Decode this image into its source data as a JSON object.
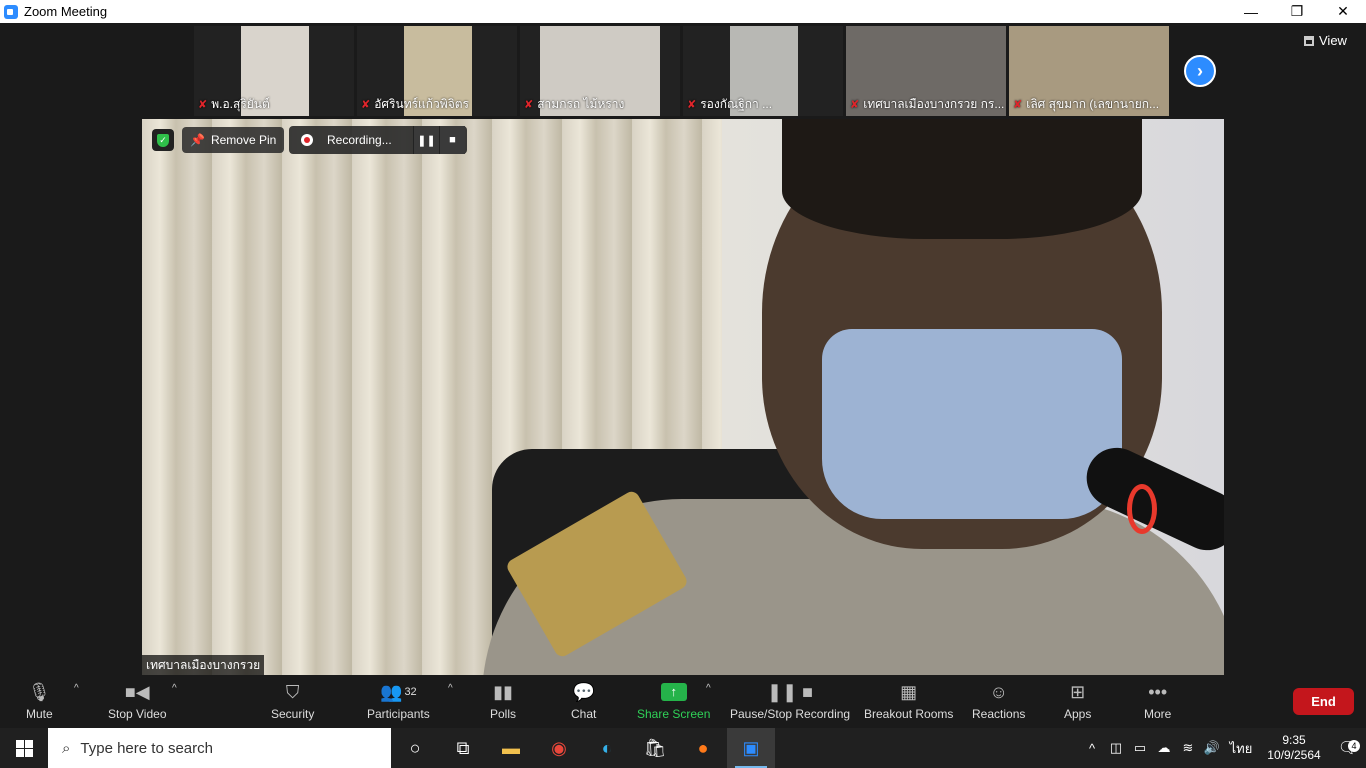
{
  "window": {
    "title": "Zoom Meeting",
    "minimize": "—",
    "restore": "❐",
    "close": "✕"
  },
  "view_label": "View",
  "participants_strip": [
    {
      "name": "พ.อ.สุริยันต์"
    },
    {
      "name": "อัศรินทร์แก้วพิจิตร"
    },
    {
      "name": "สามกรถ ไม้หราง"
    },
    {
      "name": "รองกัณฐิกา ..."
    },
    {
      "name": "เทศบาลเมืองบางกรวย กร..."
    },
    {
      "name": "เลิศ สุขมาก (เลขานายก..."
    }
  ],
  "speaker": {
    "name": "เทศบาลเมืองบางกรวย",
    "remove_pin_label": "Remove Pin",
    "recording_label": "Recording..."
  },
  "toolbar": {
    "mute": "Mute",
    "stop_video": "Stop Video",
    "security": "Security",
    "participants": "Participants",
    "participants_count": "32",
    "polls": "Polls",
    "chat": "Chat",
    "share_screen": "Share Screen",
    "pause_stop_recording": "Pause/Stop Recording",
    "breakout_rooms": "Breakout Rooms",
    "reactions": "Reactions",
    "apps": "Apps",
    "more": "More",
    "end": "End"
  },
  "taskbar": {
    "search_placeholder": "Type here to search",
    "language": "ไทย",
    "time": "9:35",
    "date": "10/9/2564",
    "notification_count": "4"
  },
  "colors": {
    "zoom_blue": "#2d8cff",
    "end_red": "#c4161c",
    "share_green": "#25b34a"
  }
}
